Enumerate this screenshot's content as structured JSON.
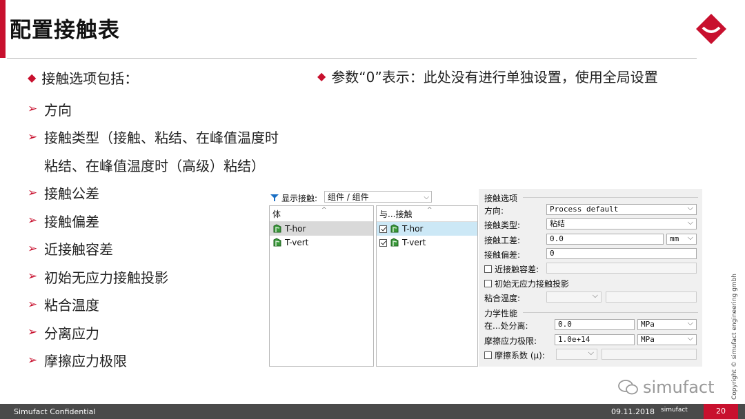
{
  "title": "配置接触表",
  "bullet_head": "接触选项包括：",
  "note": "参数“0”表示：此处没有进行单独设置，使用全局设置",
  "items": [
    "方向",
    "接触类型（接触、粘结、在峰值温度时",
    "粘结、在峰值温度时（高级）粘结）",
    "接触公差",
    "接触偏差",
    "近接触容差",
    "初始无应力接触投影",
    "粘合温度",
    "分离应力",
    "摩擦应力极限"
  ],
  "panel": {
    "filter_label": "显示接触:",
    "filter_value": "组件 / 组件",
    "body_header": "体",
    "contact_header": "与...接触",
    "body_rows": [
      "T-hor",
      "T-vert"
    ],
    "contact_rows": [
      "T-hor",
      "T-vert"
    ],
    "options": {
      "group1": "接触选项",
      "direction_label": "方向:",
      "direction_value": "Process default",
      "type_label": "接触类型:",
      "type_value": "粘结",
      "tol_label": "接触工差:",
      "tol_value": "0.0",
      "tol_unit": "mm",
      "offset_label": "接触偏差:",
      "offset_value": "0",
      "near_label": "近接触容差:",
      "proj_label": "初始无应力接触投影",
      "bond_temp_label": "粘合温度:",
      "group2": "力学性能",
      "sep_label": "在...处分离:",
      "sep_value": "0.0",
      "sep_unit": "MPa",
      "fric_label": "摩擦应力极限:",
      "fric_value": "1.0e+14",
      "fric_unit": "MPa",
      "coef_label": "摩擦系数 (μ):"
    }
  },
  "footer": {
    "left": "Simufact Confidential",
    "date": "09.11.2018",
    "brand": "simufact",
    "page": "20"
  },
  "copyright": "Copyright © simufact engineering gmbh",
  "watermark": "simufact",
  "colors": {
    "accent": "#c8102e",
    "footer": "#4a4a4a"
  }
}
